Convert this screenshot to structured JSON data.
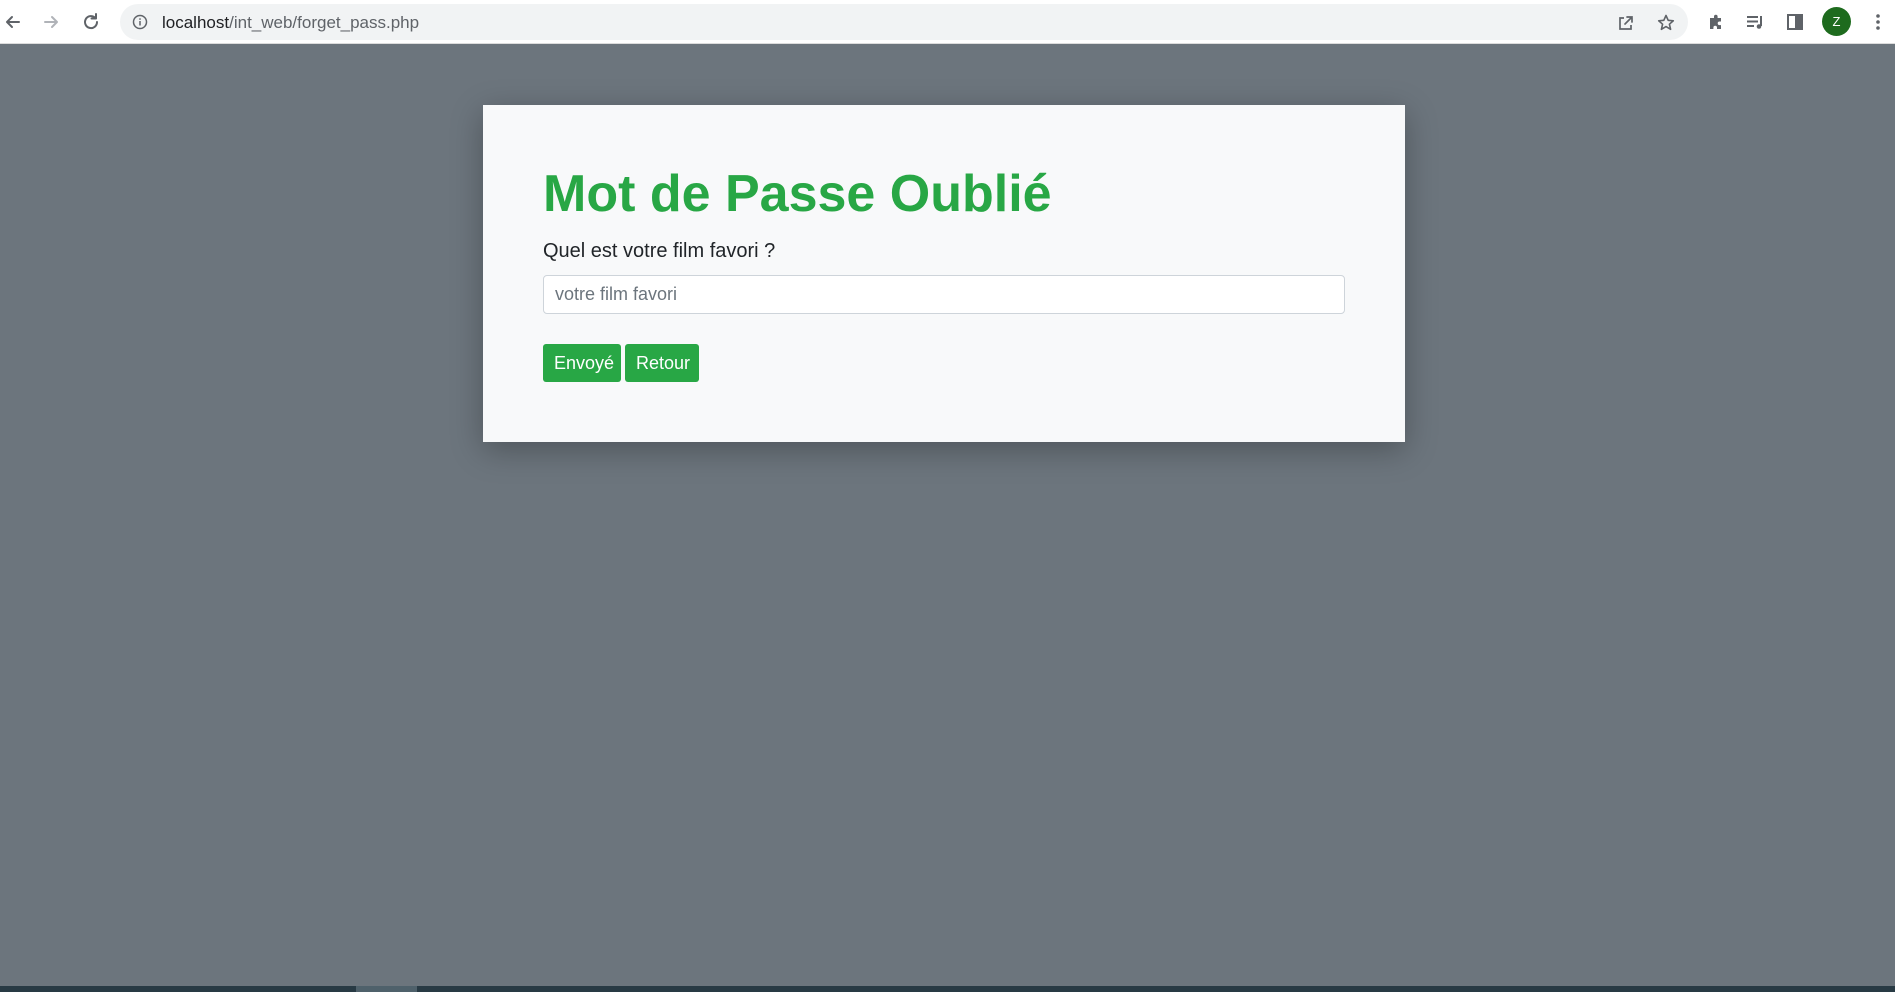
{
  "browser": {
    "url_host": "localhost",
    "url_path": "/int_web/forget_pass.php",
    "avatar_letter": "Z",
    "icons": {
      "back": "back-arrow-icon",
      "forward": "forward-arrow-icon",
      "reload": "reload-icon",
      "info": "info-icon",
      "share": "share-icon",
      "bookmark": "star-icon",
      "extensions": "puzzle-icon",
      "media": "media-queue-icon",
      "sidepanel": "side-panel-icon",
      "menu": "kebab-menu-icon"
    }
  },
  "page": {
    "title": "Mot de Passe Oublié",
    "question": "Quel est votre film favori ?",
    "input_placeholder": "votre film favori",
    "input_value": "",
    "submit_label": "Envoyé",
    "back_label": "Retour"
  },
  "colors": {
    "background": "#6c757d",
    "card": "#f8f9fa",
    "accent_green": "#28a745",
    "avatar": "#1e6b1e"
  }
}
